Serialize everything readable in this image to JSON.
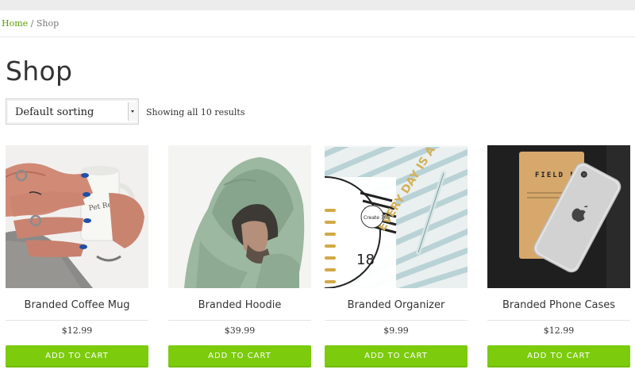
{
  "breadcrumb": {
    "home": "Home",
    "separator": " / ",
    "current": "Shop"
  },
  "page_title": "Shop",
  "sorting": {
    "selected": "Default sorting"
  },
  "result_count": "Showing all 10 results",
  "products": [
    {
      "name": "Branded Coffee Mug",
      "price": "$12.99",
      "button": "ADD TO CART"
    },
    {
      "name": "Branded Hoodie",
      "price": "$39.99",
      "button": "ADD TO CART"
    },
    {
      "name": "Branded Organizer",
      "price": "$9.99",
      "button": "ADD TO CART"
    },
    {
      "name": "Branded Phone Cases",
      "price": "$12.99",
      "button": "ADD TO CART"
    }
  ],
  "product_images": {
    "0": {
      "brand_text": "Pet Regis"
    },
    "2": {
      "big_text": "EVERY DAY IS A GIFT",
      "sticker_text": "Create 365",
      "page_number": "18"
    },
    "3": {
      "book_text": "FIELD NOTES"
    }
  },
  "colors": {
    "accent": "#7ccb0d",
    "link": "#5a9e00"
  }
}
